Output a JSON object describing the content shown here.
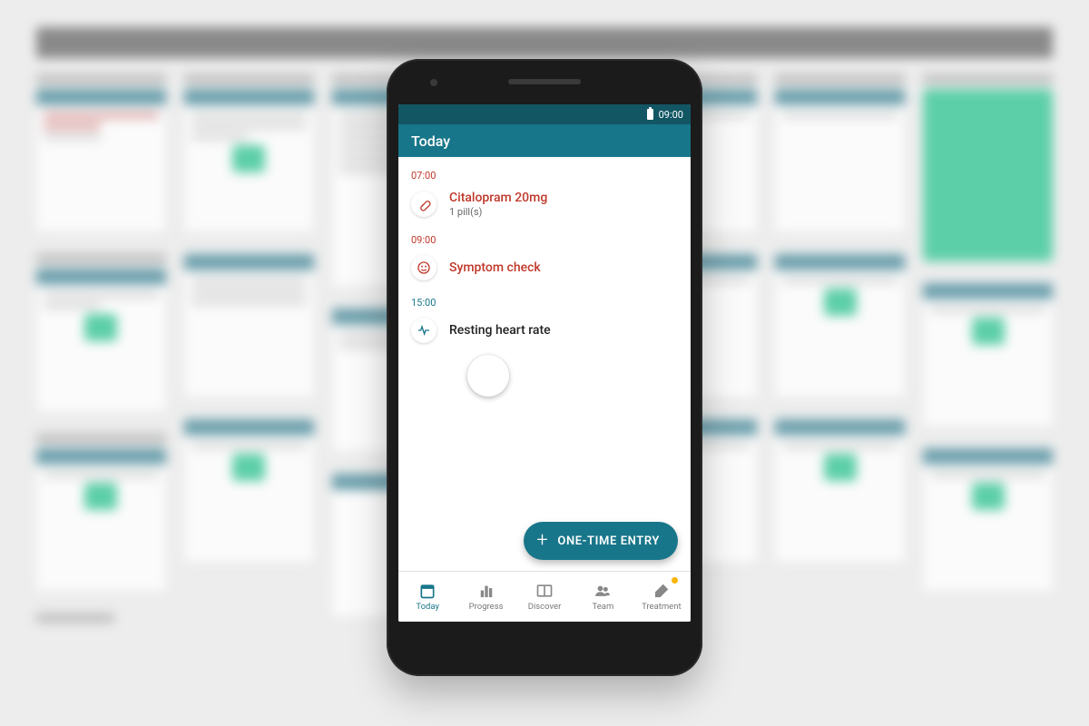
{
  "statusbar": {
    "time": "09:00"
  },
  "appbar": {
    "title": "Today"
  },
  "schedule": [
    {
      "time": "07:00",
      "state": "overdue",
      "icon": "pill",
      "title": "Citalopram 20mg",
      "subtitle": "1 pill(s)"
    },
    {
      "time": "09:00",
      "state": "overdue",
      "icon": "face",
      "title": "Symptom check",
      "subtitle": ""
    },
    {
      "time": "15:00",
      "state": "upcoming",
      "icon": "heartbeat",
      "title": "Resting heart rate",
      "subtitle": ""
    }
  ],
  "fab": {
    "label": "ONE-TIME ENTRY"
  },
  "nav": {
    "items": [
      {
        "label": "Today",
        "icon": "today",
        "active": true,
        "badge": false
      },
      {
        "label": "Progress",
        "icon": "progress",
        "active": false,
        "badge": false
      },
      {
        "label": "Discover",
        "icon": "discover",
        "active": false,
        "badge": false
      },
      {
        "label": "Team",
        "icon": "team",
        "active": false,
        "badge": false
      },
      {
        "label": "Treatment",
        "icon": "treatment",
        "active": false,
        "badge": true
      }
    ]
  },
  "colors": {
    "brand": "#18768a",
    "brandDark": "#125664",
    "overdue": "#c0392b",
    "accentGreen": "#4dcca1"
  }
}
